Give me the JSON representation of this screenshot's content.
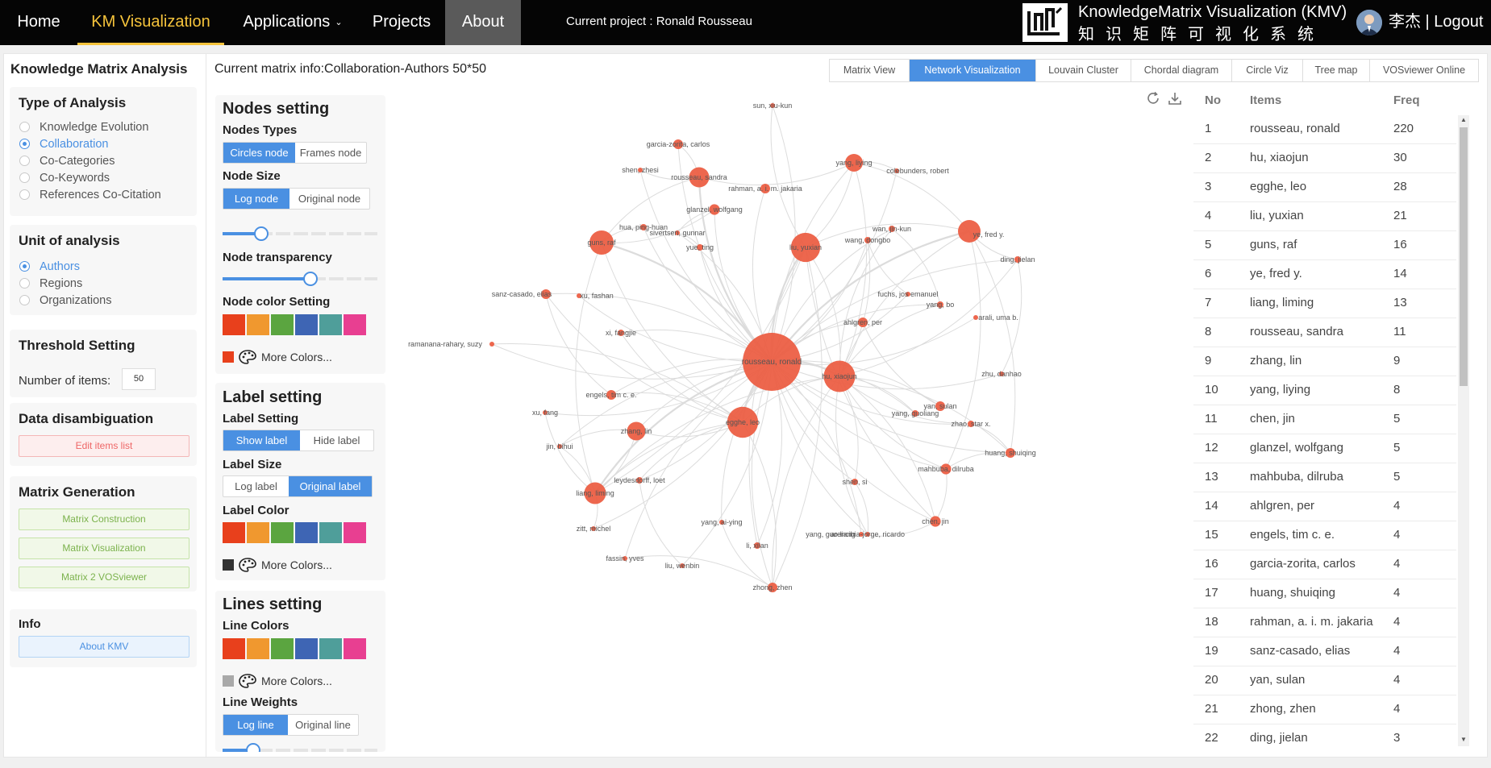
{
  "nav": {
    "home": "Home",
    "km_visualization": "KM Visualization",
    "applications": "Applications",
    "projects": "Projects",
    "about": "About",
    "current_project": "Current project : Ronald Rousseau",
    "logo_title": "KnowledgeMatrix Visualization (KMV)",
    "logo_subtitle": "知识矩阵可视化系统",
    "user": "李杰 | Logout"
  },
  "sidebar": {
    "title": "Knowledge Matrix Analysis",
    "type_of_analysis": {
      "title": "Type of Analysis",
      "options": [
        "Knowledge Evolution",
        "Collaboration",
        "Co-Categories",
        "Co-Keywords",
        "References Co-Citation"
      ],
      "selected": "Collaboration"
    },
    "unit_of_analysis": {
      "title": "Unit of analysis",
      "options": [
        "Authors",
        "Regions",
        "Organizations"
      ],
      "selected": "Authors"
    },
    "threshold": {
      "title": "Threshold Setting",
      "label": "Number of items:",
      "value": "50"
    },
    "disambiguation": {
      "title": "Data disambiguation",
      "button": "Edit items list"
    },
    "matrix_generation": {
      "title": "Matrix Generation",
      "buttons": [
        "Matrix Construction",
        "Matrix Visualization",
        "Matrix 2 VOSviewer"
      ]
    },
    "info": {
      "title": "Info",
      "button": "About KMV"
    }
  },
  "header": {
    "matrix_info": "Current matrix info:Collaboration-Authors  50*50",
    "tabs": [
      "Matrix View",
      "Network Visualization",
      "Louvain Cluster",
      "Chordal diagram",
      "Circle Viz",
      "Tree map",
      "VOSviewer Online"
    ],
    "active_tab": "Network Visualization"
  },
  "settings": {
    "nodes": {
      "title": "Nodes setting",
      "types_label": "Nodes Types",
      "types": [
        "Circles node",
        "Frames node"
      ],
      "size_label": "Node Size",
      "sizes": [
        "Log node",
        "Original node"
      ],
      "size_slider": 0.25,
      "transparency_label": "Node transparency",
      "transparency_slider": 0.57,
      "color_label": "Node color Setting",
      "more_colors": "More Colors...",
      "current_color": "#e8401c"
    },
    "label": {
      "title": "Label setting",
      "setting_label": "Label Setting",
      "settings": [
        "Show label",
        "Hide label"
      ],
      "size_label": "Label Size",
      "sizes": [
        "Log label",
        "Original label"
      ],
      "color_label": "Label Color",
      "more_colors": "More Colors...",
      "current_color": "#333333"
    },
    "lines": {
      "title": "Lines setting",
      "colors_label": "Line Colors",
      "more_colors": "More Colors...",
      "current_color": "#a9a9a9",
      "weights_label": "Line Weights",
      "weights": [
        "Log line",
        "Original line"
      ]
    },
    "palette": [
      "#e8401c",
      "#f0982f",
      "#5ba540",
      "#3e65b4",
      "#4f9e9a",
      "#e83f91"
    ]
  },
  "graph": {
    "node_color": "#ec5a3f",
    "edge_color": "#dcdcdc",
    "nodes": [
      {
        "label": "rousseau, ronald",
        "freq": 220
      },
      {
        "label": "hu, xiaojun",
        "freq": 30
      },
      {
        "label": "egghe, leo",
        "freq": 28
      },
      {
        "label": "liu, yuxian",
        "freq": 21
      },
      {
        "label": "guns, raf",
        "freq": 16
      },
      {
        "label": "ye, fred y.",
        "freq": 14
      },
      {
        "label": "liang, liming",
        "freq": 13
      },
      {
        "label": "rousseau, sandra",
        "freq": 11
      },
      {
        "label": "zhang, lin",
        "freq": 9
      },
      {
        "label": "yang, liying",
        "freq": 8
      },
      {
        "label": "chen, jin",
        "freq": 5
      },
      {
        "label": "glanzel, wolfgang",
        "freq": 5
      },
      {
        "label": "mahbuba, dilruba",
        "freq": 5
      },
      {
        "label": "ahlgren, per",
        "freq": 4
      },
      {
        "label": "engels, tim c. e.",
        "freq": 4
      },
      {
        "label": "garcia-zorita, carlos",
        "freq": 4
      },
      {
        "label": "huang, shuiqing",
        "freq": 4
      },
      {
        "label": "rahman, a. i. m. jakaria",
        "freq": 4
      },
      {
        "label": "sanz-casado, elias",
        "freq": 4
      },
      {
        "label": "yan, sulan",
        "freq": 4
      },
      {
        "label": "zhong, zhen",
        "freq": 4
      },
      {
        "label": "ding, jielan",
        "freq": 3
      },
      {
        "label": "sun, xiu-kun",
        "freq": 1
      },
      {
        "label": "shen, zhesi",
        "freq": 1
      },
      {
        "label": "colebunders, robert",
        "freq": 1
      },
      {
        "label": "hua, ping-huan",
        "freq": 2
      },
      {
        "label": "sivertsen, gunnar",
        "freq": 1
      },
      {
        "label": "yue, ting",
        "freq": 2
      },
      {
        "label": "wang, dongbo",
        "freq": 2
      },
      {
        "label": "wan, jin-kun",
        "freq": 2
      },
      {
        "label": "fuchs, jos emanuel",
        "freq": 1
      },
      {
        "label": "yang, bo",
        "freq": 2
      },
      {
        "label": "arali, uma b.",
        "freq": 1
      },
      {
        "label": "xu, fashan",
        "freq": 1
      },
      {
        "label": "xi, fangjie",
        "freq": 2
      },
      {
        "label": "ramanana-rahary, suzy",
        "freq": 1
      },
      {
        "label": "zhu, danhao",
        "freq": 1
      },
      {
        "label": "yang, guoliang",
        "freq": 2
      },
      {
        "label": "zhao, star x.",
        "freq": 2
      },
      {
        "label": "xu, fang",
        "freq": 1
      },
      {
        "label": "jin, bihui",
        "freq": 1
      },
      {
        "label": "leydesdorff, loet",
        "freq": 2
      },
      {
        "label": "shen, si",
        "freq": 2
      },
      {
        "label": "zitt, michel",
        "freq": 1
      },
      {
        "label": "yang, ai-ying",
        "freq": 1
      },
      {
        "label": "li, xilan",
        "freq": 2
      },
      {
        "label": "arencibia-jorge, ricardo",
        "freq": 1
      },
      {
        "label": "yang, guo-liang",
        "freq": 1
      },
      {
        "label": "fassin, yves",
        "freq": 1
      },
      {
        "label": "liu, wenbin",
        "freq": 1
      }
    ]
  },
  "table": {
    "headers": [
      "No",
      "Items",
      "Freq"
    ],
    "rows": [
      [
        "1",
        "rousseau, ronald",
        "220"
      ],
      [
        "2",
        "hu, xiaojun",
        "30"
      ],
      [
        "3",
        "egghe, leo",
        "28"
      ],
      [
        "4",
        "liu, yuxian",
        "21"
      ],
      [
        "5",
        "guns, raf",
        "16"
      ],
      [
        "6",
        "ye, fred y.",
        "14"
      ],
      [
        "7",
        "liang, liming",
        "13"
      ],
      [
        "8",
        "rousseau, sandra",
        "11"
      ],
      [
        "9",
        "zhang, lin",
        "9"
      ],
      [
        "10",
        "yang, liying",
        "8"
      ],
      [
        "11",
        "chen, jin",
        "5"
      ],
      [
        "12",
        "glanzel, wolfgang",
        "5"
      ],
      [
        "13",
        "mahbuba, dilruba",
        "5"
      ],
      [
        "14",
        "ahlgren, per",
        "4"
      ],
      [
        "15",
        "engels, tim c. e.",
        "4"
      ],
      [
        "16",
        "garcia-zorita, carlos",
        "4"
      ],
      [
        "17",
        "huang, shuiqing",
        "4"
      ],
      [
        "18",
        "rahman, a. i. m. jakaria",
        "4"
      ],
      [
        "19",
        "sanz-casado, elias",
        "4"
      ],
      [
        "20",
        "yan, sulan",
        "4"
      ],
      [
        "21",
        "zhong, zhen",
        "4"
      ],
      [
        "22",
        "ding, jielan",
        "3"
      ]
    ]
  }
}
